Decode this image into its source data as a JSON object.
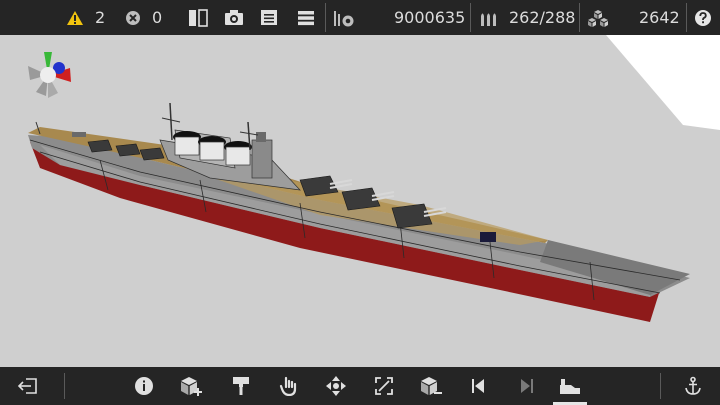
{
  "topbar": {
    "warning_count": "2",
    "error_count": "0",
    "tonnage": "9000635",
    "ammo": "262/288",
    "parts": "2642",
    "icons": [
      "warning-icon",
      "error-icon",
      "split-view-icon",
      "camera-icon",
      "document-icon",
      "menu-icon",
      "gauge-icon",
      "ammo-icon",
      "parts-icon",
      "help-icon"
    ]
  },
  "bottombar": {
    "icons": [
      "exit-icon",
      "info-icon",
      "add-part-icon",
      "paint-icon",
      "hand-icon",
      "move-icon",
      "scale-icon",
      "remove-part-icon",
      "previous-icon",
      "next-icon",
      "factory-icon",
      "anchor-icon"
    ],
    "active": "factory-icon"
  },
  "colors": {
    "bar_bg": "#252525",
    "viewport_bg": "#cfcfcf",
    "hull_gray": "#8f8f8f",
    "hull_red": "#8e1a1a",
    "deck_wood": "#a8894e",
    "warning_yellow": "#f1c40f"
  }
}
